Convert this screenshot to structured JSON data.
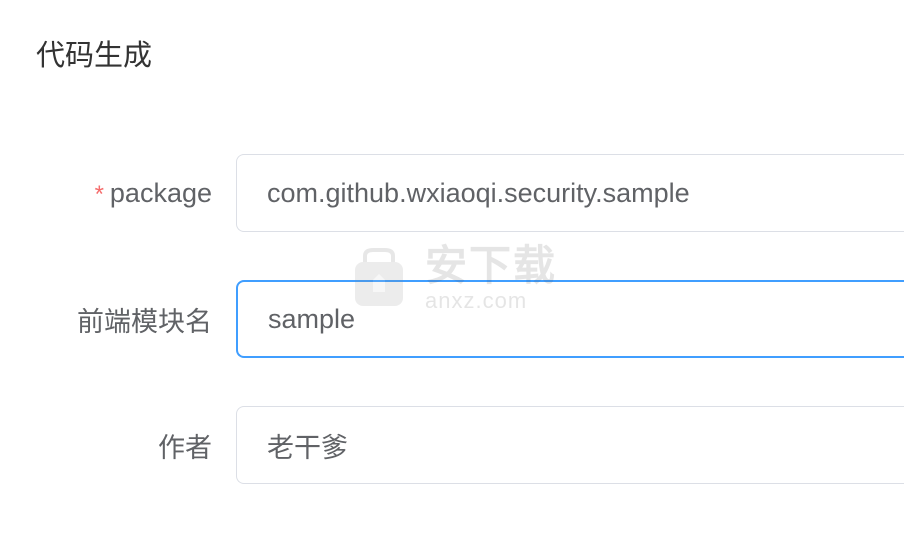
{
  "page": {
    "title": "代码生成"
  },
  "form": {
    "package": {
      "label": "package",
      "required": true,
      "value": "com.github.wxiaoqi.security.sample"
    },
    "frontend_module": {
      "label": "前端模块名",
      "required": false,
      "value": "sample"
    },
    "author": {
      "label": "作者",
      "required": false,
      "value": "老干爹"
    }
  },
  "watermark": {
    "main": "安下载",
    "sub": "anxz.com"
  }
}
